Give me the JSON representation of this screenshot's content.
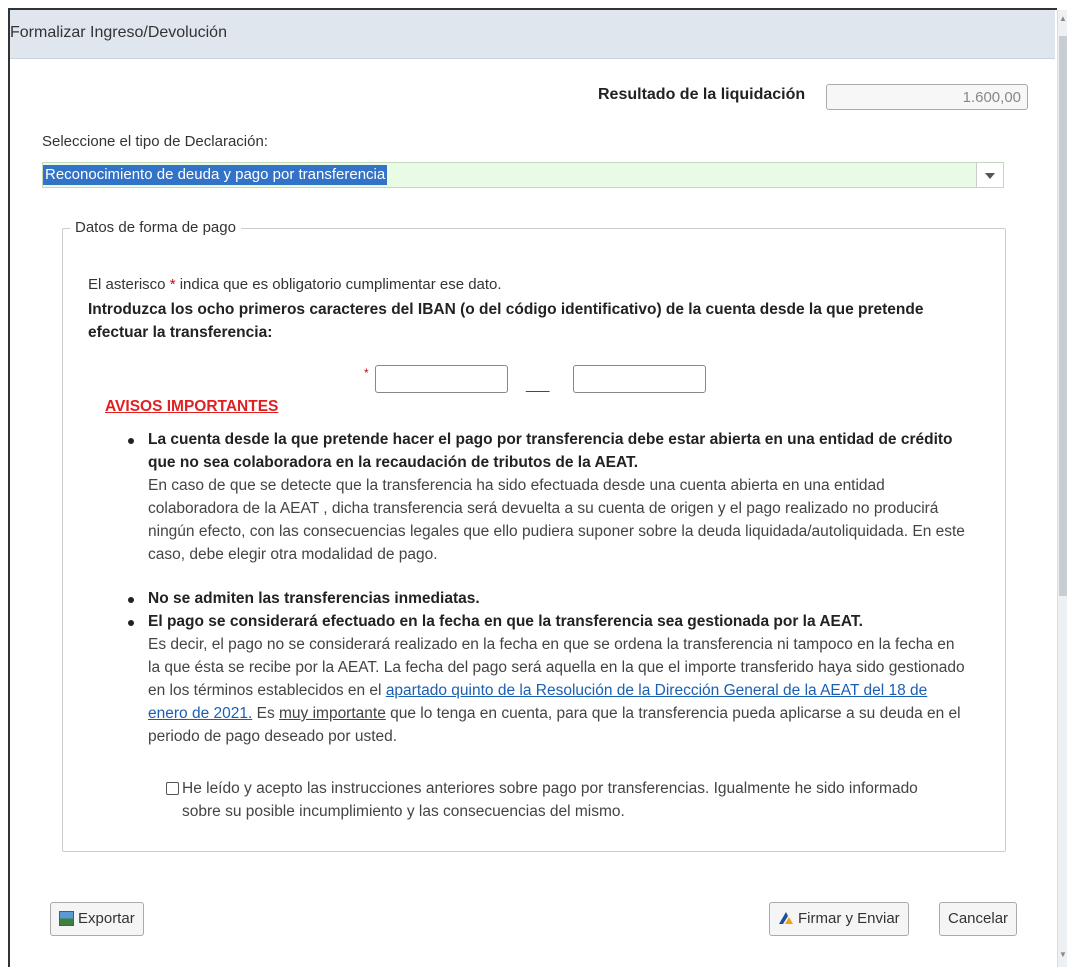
{
  "window": {
    "title": "Formalizar Ingreso/Devolución"
  },
  "result": {
    "label": "Resultado de la liquidación",
    "value": "1.600,00"
  },
  "declaration": {
    "label": "Seleccione el tipo de Declaración:",
    "selected": "Reconocimiento de deuda y pago por transferencia"
  },
  "payment": {
    "legend": "Datos de forma de pago",
    "asterisk_note_prefix": "El asterisco ",
    "asterisk": "*",
    "asterisk_note_suffix": " indica que es obligatorio cumplimentar ese dato.",
    "iban_instruction": "Introduzca los ocho primeros caracteres del IBAN (o del código identificativo) de la cuenta desde la que pretende efectuar la transferencia:",
    "iban_part1": "",
    "iban_separator": "___",
    "iban_part2": ""
  },
  "notices": {
    "heading": "AVISOS IMPORTANTES",
    "item1_bold": "La cuenta desde la que pretende hacer el pago por transferencia debe estar abierta en una entidad de crédito que no sea colaboradora en la recaudación de tributos de la AEAT.",
    "item1_text": "En caso de que se detecte que la transferencia ha sido efectuada desde una cuenta abierta en una entidad colaboradora de la AEAT , dicha transferencia será devuelta a  su cuenta de origen y el pago realizado no producirá ningún efecto, con las consecuencias legales que ello pudiera suponer sobre la deuda liquidada/autoliquidada. En este caso, debe elegir otra modalidad de pago.",
    "item2_bold": "No se admiten las transferencias inmediatas.",
    "item3_bold": "El pago se considerará efectuado en la fecha en que la transferencia sea gestionada por la AEAT.",
    "item3_text_a": "Es decir, el pago no se considerará realizado en la fecha en que se ordena la transferencia ni tampoco en la fecha en la que ésta se recibe por la AEAT. La fecha del pago será aquella en la que el importe transferido haya sido gestionado en los términos establecidos en el ",
    "item3_link": "apartado quinto de la Resolución de la Dirección General de la AEAT del 18 de enero de 2021.",
    "item3_text_b": " Es ",
    "item3_underline": "muy importante",
    "item3_text_c": " que lo tenga en cuenta, para que la transferencia pueda aplicarse a su deuda en el periodo de pago deseado por usted."
  },
  "acknowledge": {
    "checked": false,
    "label": "He leído y acepto las instrucciones anteriores sobre pago por transferencias. Igualmente he sido informado sobre su posible incumplimiento y las consecuencias del mismo."
  },
  "buttons": {
    "export": "Exportar",
    "sign": "Firmar y Enviar",
    "cancel": "Cancelar"
  },
  "icons": {
    "export": "export-icon",
    "sign": "sign-icon"
  },
  "colors": {
    "title_bg": "#dfe6ee",
    "select_bg": "#e8fbe4",
    "selection": "#3373c7",
    "warning": "#e02020",
    "link": "#1a5fb4",
    "required": "#d0021b"
  }
}
